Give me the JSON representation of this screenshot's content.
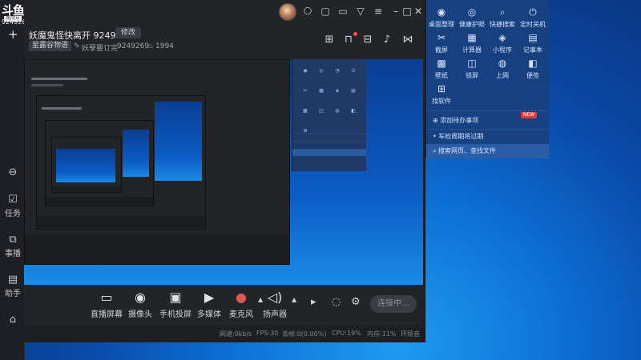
{
  "app": {
    "logo_text": "斗鱼",
    "logo_sub": "房间号",
    "room_id": "9249269"
  },
  "left_side": {
    "items": [
      {
        "label": "任务",
        "icon": "task-icon"
      },
      {
        "label": "事播",
        "icon": "live-icon"
      },
      {
        "label": "助手",
        "icon": "assistant-icon"
      }
    ]
  },
  "titlebar": {
    "icons": [
      "gift-icon",
      "message-icon",
      "wallet-icon",
      "shirt-icon",
      "menu-icon",
      "minimize-icon",
      "maximize-icon",
      "close-icon"
    ]
  },
  "stream": {
    "title": "妖魔鬼怪快离开 9249269",
    "edit_label": "修改",
    "category": "星露谷物语",
    "subcategory": "妖孽要订完",
    "room_id": "9249269",
    "heat": "1994"
  },
  "controls": {
    "items": [
      {
        "label": "直播屏幕",
        "icon": "screen-icon"
      },
      {
        "label": "摄像头",
        "icon": "camera-icon"
      },
      {
        "label": "手机投屏",
        "icon": "phone-cast-icon"
      },
      {
        "label": "多媒体",
        "icon": "media-icon"
      },
      {
        "label": "麦克风",
        "icon": "microphone-icon"
      },
      {
        "label": "扬声器",
        "icon": "speaker-icon"
      }
    ],
    "connect_label": "连接中..."
  },
  "status": {
    "network": "网速:0kb/s",
    "fps": "FPS:30",
    "dropped": "丢帧:0(0.00%)",
    "cpu": "CPU:19%",
    "memory": "内存:11%",
    "mic": "环境音"
  },
  "quick_panel": {
    "items": [
      {
        "label": "桌面整理",
        "icon": "desktop-icon"
      },
      {
        "label": "健康护眼",
        "icon": "eye-icon"
      },
      {
        "label": "快捷搜索",
        "icon": "search-icon"
      },
      {
        "label": "定时关机",
        "icon": "power-icon"
      },
      {
        "label": "截屏",
        "icon": "scissors-icon"
      },
      {
        "label": "计算器",
        "icon": "calculator-icon"
      },
      {
        "label": "小程序",
        "icon": "miniapp-icon"
      },
      {
        "label": "记事本",
        "icon": "notepad-icon"
      },
      {
        "label": "壁纸",
        "icon": "wallpaper-icon"
      },
      {
        "label": "锁屏",
        "icon": "lock-icon"
      },
      {
        "label": "上网",
        "icon": "globe-icon"
      },
      {
        "label": "便签",
        "icon": "sticky-note-icon"
      },
      {
        "label": "找软件",
        "icon": "app-search-icon"
      }
    ],
    "new_badge": "NEW",
    "todo": "添加待办事项",
    "recent": "车检周期将过期",
    "search": "搜索网页、查找文件"
  }
}
